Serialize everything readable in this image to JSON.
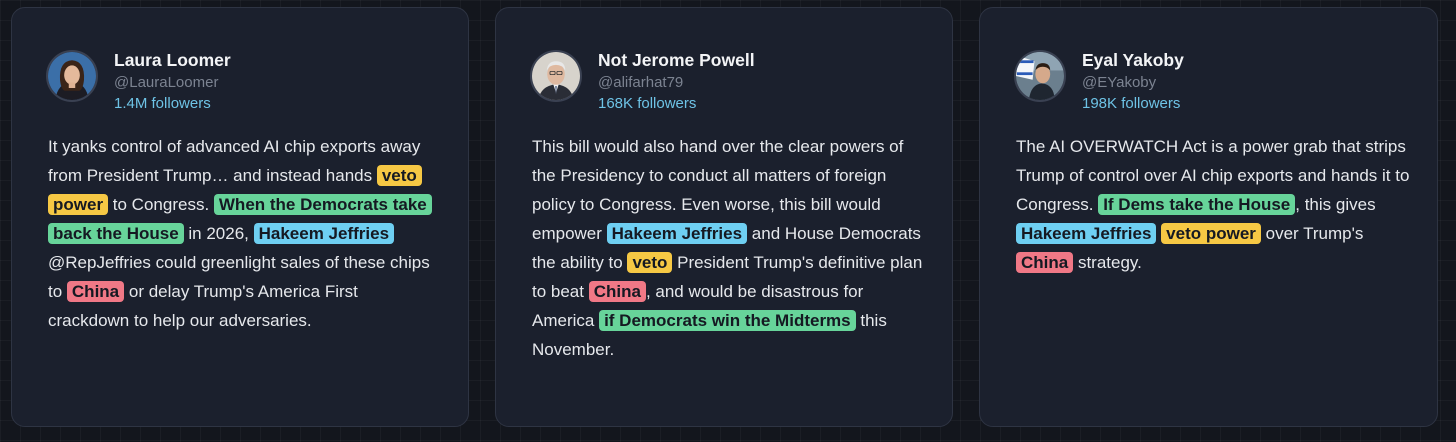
{
  "colors": {
    "yellow": "#f6c844",
    "green": "#67d49a",
    "blue": "#6ecff2",
    "red": "#f07886",
    "followers": "#6ec3e6"
  },
  "cards": [
    {
      "name": "Laura Loomer",
      "handle": "@LauraLoomer",
      "followers": "1.4M followers",
      "avatar_icon": "avatar-woman-icon",
      "segments": [
        {
          "text": "It yanks control of advanced AI chip exports away from President Trump… and instead hands "
        },
        {
          "text": "veto power",
          "hl": "yellow"
        },
        {
          "text": " to Congress. "
        },
        {
          "text": "When the Democrats take back the House",
          "hl": "green"
        },
        {
          "text": " in 2026, "
        },
        {
          "text": "Hakeem Jeffries",
          "hl": "blue"
        },
        {
          "text": " @RepJeffries could greenlight sales of these chips to "
        },
        {
          "text": "China",
          "hl": "red"
        },
        {
          "text": " or delay Trump's America First crackdown to help our adversaries."
        }
      ]
    },
    {
      "name": "Not Jerome Powell",
      "handle": "@alifarhat79",
      "followers": "168K followers",
      "avatar_icon": "avatar-man-suit-icon",
      "segments": [
        {
          "text": "This bill would also hand over the clear powers of the Presidency to conduct all matters of foreign policy to Congress. Even worse, this bill would empower "
        },
        {
          "text": "Hakeem Jeffries",
          "hl": "blue"
        },
        {
          "text": " and House Democrats the ability to "
        },
        {
          "text": "veto",
          "hl": "yellow"
        },
        {
          "text": " President Trump's definitive plan to beat "
        },
        {
          "text": "China",
          "hl": "red"
        },
        {
          "text": ", and would be disastrous for America "
        },
        {
          "text": "if Democrats win the Midterms",
          "hl": "green"
        },
        {
          "text": " this November."
        }
      ]
    },
    {
      "name": "Eyal Yakoby",
      "handle": "@EYakoby",
      "followers": "198K followers",
      "avatar_icon": "avatar-man-flag-icon",
      "segments": [
        {
          "text": "The AI OVERWATCH Act is a power grab that strips Trump of control over AI chip exports and hands it to Congress. "
        },
        {
          "text": "If Dems take the House",
          "hl": "green"
        },
        {
          "text": ", this gives "
        },
        {
          "text": "Hakeem Jeffries",
          "hl": "blue"
        },
        {
          "text": " "
        },
        {
          "text": "veto power",
          "hl": "yellow"
        },
        {
          "text": " over Trump's "
        },
        {
          "text": "China",
          "hl": "red"
        },
        {
          "text": " strategy."
        }
      ]
    }
  ]
}
